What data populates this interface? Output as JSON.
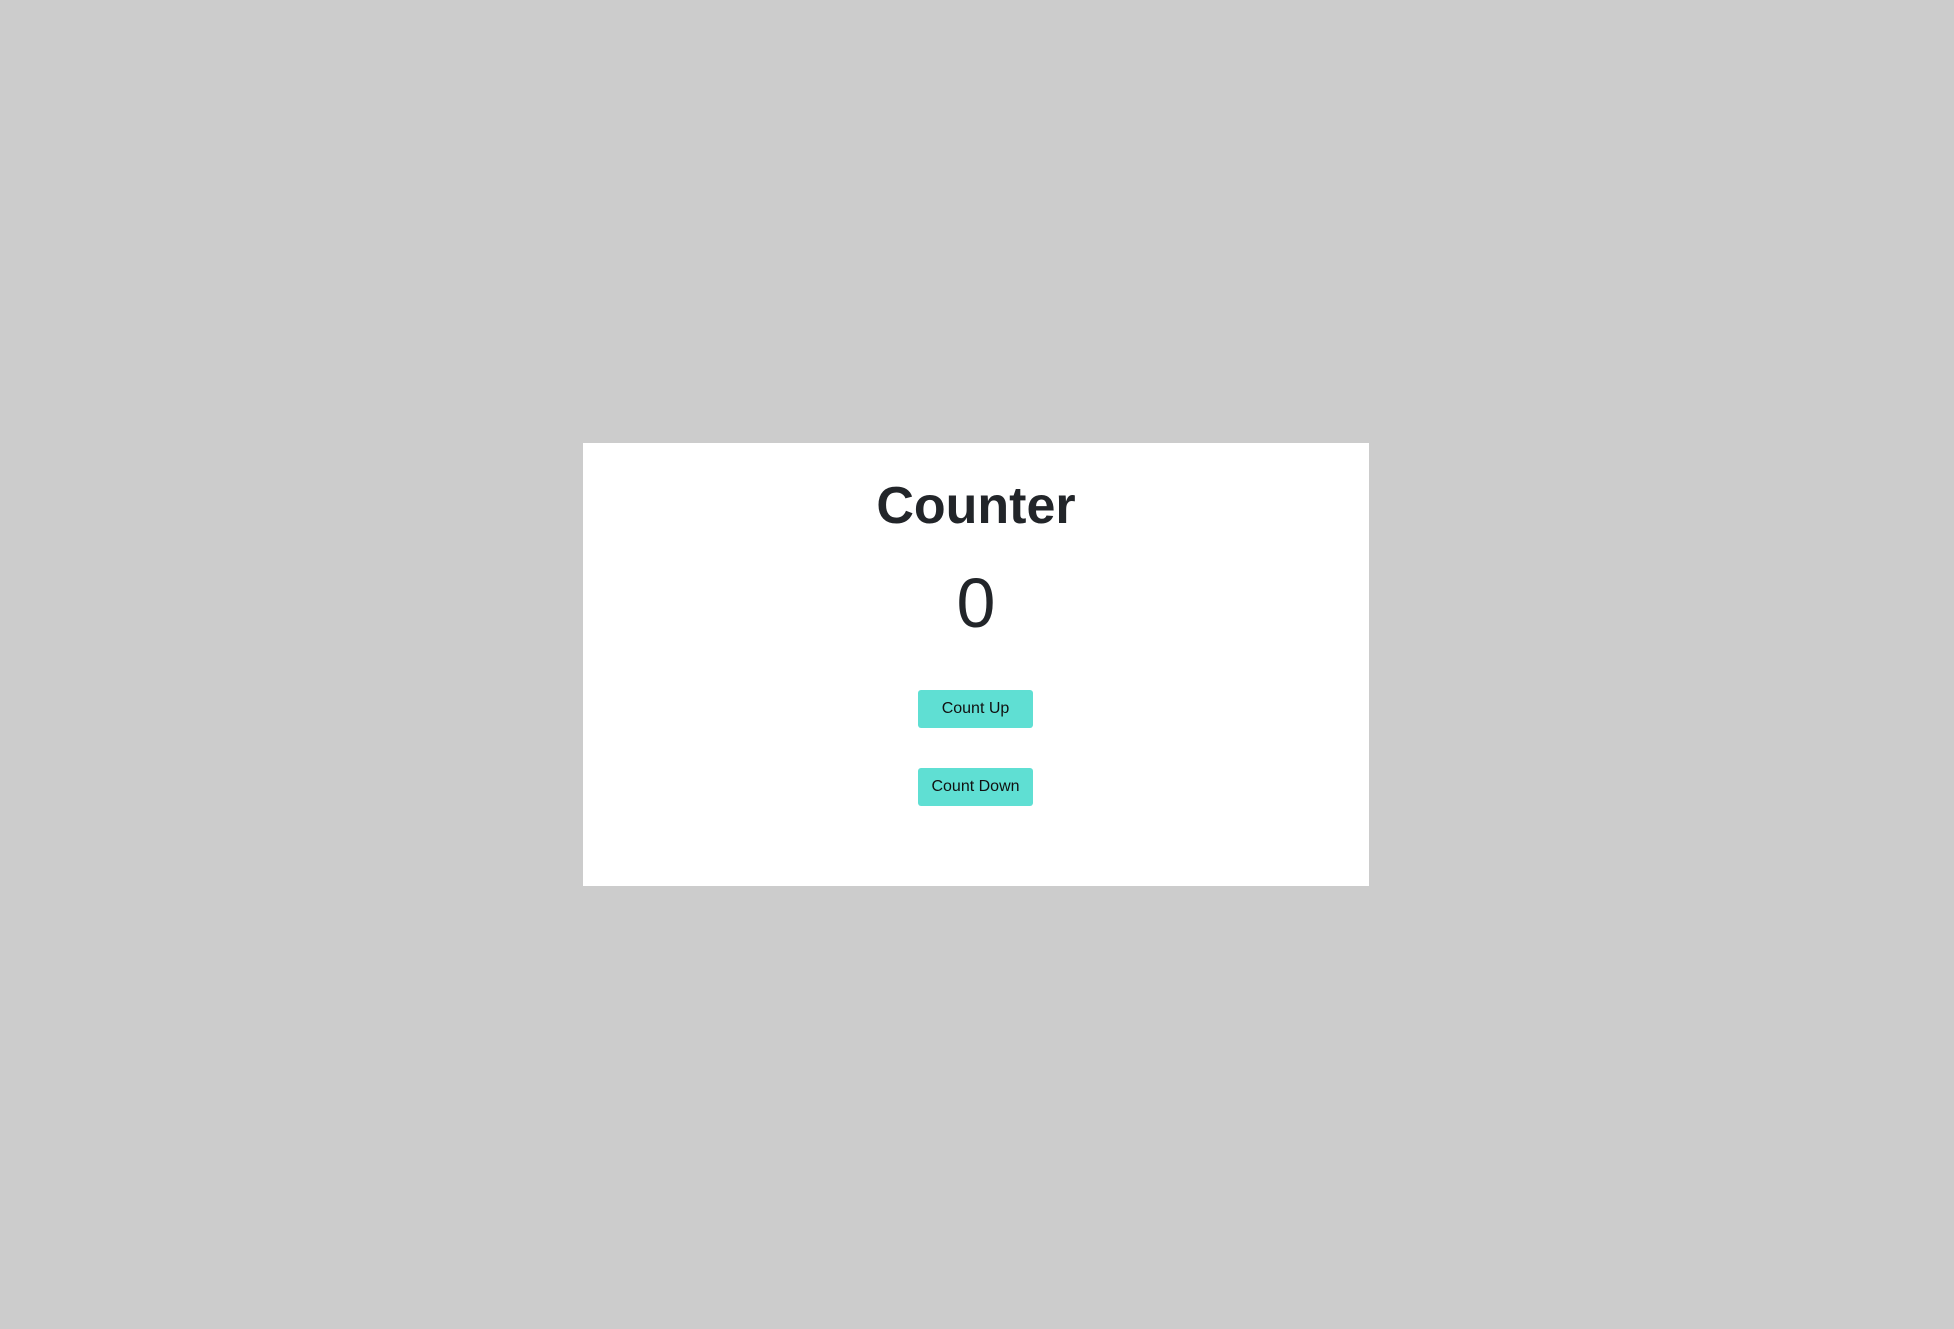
{
  "counter": {
    "title": "Counter",
    "value": "0",
    "count_up_label": "Count Up",
    "count_down_label": "Count Down"
  },
  "colors": {
    "page_background": "#cccccc",
    "card_background": "#ffffff",
    "button_background": "#5fdfd3",
    "text": "#222529"
  }
}
